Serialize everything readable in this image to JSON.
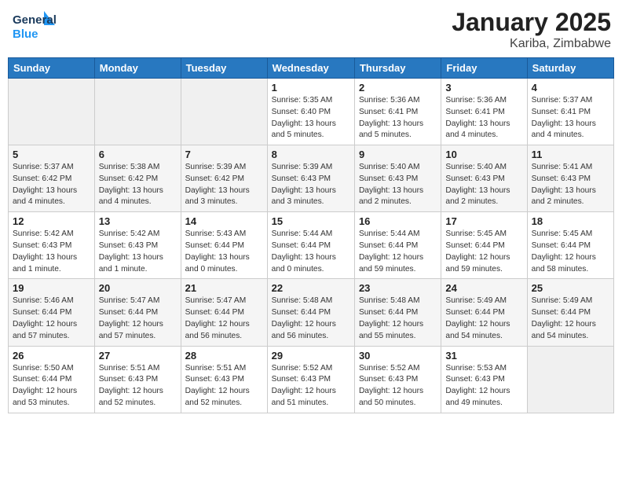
{
  "header": {
    "logo_line1": "General",
    "logo_line2": "Blue",
    "month": "January 2025",
    "location": "Kariba, Zimbabwe"
  },
  "days_of_week": [
    "Sunday",
    "Monday",
    "Tuesday",
    "Wednesday",
    "Thursday",
    "Friday",
    "Saturday"
  ],
  "weeks": [
    [
      {
        "num": "",
        "info": ""
      },
      {
        "num": "",
        "info": ""
      },
      {
        "num": "",
        "info": ""
      },
      {
        "num": "1",
        "info": "Sunrise: 5:35 AM\nSunset: 6:40 PM\nDaylight: 13 hours\nand 5 minutes."
      },
      {
        "num": "2",
        "info": "Sunrise: 5:36 AM\nSunset: 6:41 PM\nDaylight: 13 hours\nand 5 minutes."
      },
      {
        "num": "3",
        "info": "Sunrise: 5:36 AM\nSunset: 6:41 PM\nDaylight: 13 hours\nand 4 minutes."
      },
      {
        "num": "4",
        "info": "Sunrise: 5:37 AM\nSunset: 6:41 PM\nDaylight: 13 hours\nand 4 minutes."
      }
    ],
    [
      {
        "num": "5",
        "info": "Sunrise: 5:37 AM\nSunset: 6:42 PM\nDaylight: 13 hours\nand 4 minutes."
      },
      {
        "num": "6",
        "info": "Sunrise: 5:38 AM\nSunset: 6:42 PM\nDaylight: 13 hours\nand 4 minutes."
      },
      {
        "num": "7",
        "info": "Sunrise: 5:39 AM\nSunset: 6:42 PM\nDaylight: 13 hours\nand 3 minutes."
      },
      {
        "num": "8",
        "info": "Sunrise: 5:39 AM\nSunset: 6:43 PM\nDaylight: 13 hours\nand 3 minutes."
      },
      {
        "num": "9",
        "info": "Sunrise: 5:40 AM\nSunset: 6:43 PM\nDaylight: 13 hours\nand 2 minutes."
      },
      {
        "num": "10",
        "info": "Sunrise: 5:40 AM\nSunset: 6:43 PM\nDaylight: 13 hours\nand 2 minutes."
      },
      {
        "num": "11",
        "info": "Sunrise: 5:41 AM\nSunset: 6:43 PM\nDaylight: 13 hours\nand 2 minutes."
      }
    ],
    [
      {
        "num": "12",
        "info": "Sunrise: 5:42 AM\nSunset: 6:43 PM\nDaylight: 13 hours\nand 1 minute."
      },
      {
        "num": "13",
        "info": "Sunrise: 5:42 AM\nSunset: 6:43 PM\nDaylight: 13 hours\nand 1 minute."
      },
      {
        "num": "14",
        "info": "Sunrise: 5:43 AM\nSunset: 6:44 PM\nDaylight: 13 hours\nand 0 minutes."
      },
      {
        "num": "15",
        "info": "Sunrise: 5:44 AM\nSunset: 6:44 PM\nDaylight: 13 hours\nand 0 minutes."
      },
      {
        "num": "16",
        "info": "Sunrise: 5:44 AM\nSunset: 6:44 PM\nDaylight: 12 hours\nand 59 minutes."
      },
      {
        "num": "17",
        "info": "Sunrise: 5:45 AM\nSunset: 6:44 PM\nDaylight: 12 hours\nand 59 minutes."
      },
      {
        "num": "18",
        "info": "Sunrise: 5:45 AM\nSunset: 6:44 PM\nDaylight: 12 hours\nand 58 minutes."
      }
    ],
    [
      {
        "num": "19",
        "info": "Sunrise: 5:46 AM\nSunset: 6:44 PM\nDaylight: 12 hours\nand 57 minutes."
      },
      {
        "num": "20",
        "info": "Sunrise: 5:47 AM\nSunset: 6:44 PM\nDaylight: 12 hours\nand 57 minutes."
      },
      {
        "num": "21",
        "info": "Sunrise: 5:47 AM\nSunset: 6:44 PM\nDaylight: 12 hours\nand 56 minutes."
      },
      {
        "num": "22",
        "info": "Sunrise: 5:48 AM\nSunset: 6:44 PM\nDaylight: 12 hours\nand 56 minutes."
      },
      {
        "num": "23",
        "info": "Sunrise: 5:48 AM\nSunset: 6:44 PM\nDaylight: 12 hours\nand 55 minutes."
      },
      {
        "num": "24",
        "info": "Sunrise: 5:49 AM\nSunset: 6:44 PM\nDaylight: 12 hours\nand 54 minutes."
      },
      {
        "num": "25",
        "info": "Sunrise: 5:49 AM\nSunset: 6:44 PM\nDaylight: 12 hours\nand 54 minutes."
      }
    ],
    [
      {
        "num": "26",
        "info": "Sunrise: 5:50 AM\nSunset: 6:44 PM\nDaylight: 12 hours\nand 53 minutes."
      },
      {
        "num": "27",
        "info": "Sunrise: 5:51 AM\nSunset: 6:43 PM\nDaylight: 12 hours\nand 52 minutes."
      },
      {
        "num": "28",
        "info": "Sunrise: 5:51 AM\nSunset: 6:43 PM\nDaylight: 12 hours\nand 52 minutes."
      },
      {
        "num": "29",
        "info": "Sunrise: 5:52 AM\nSunset: 6:43 PM\nDaylight: 12 hours\nand 51 minutes."
      },
      {
        "num": "30",
        "info": "Sunrise: 5:52 AM\nSunset: 6:43 PM\nDaylight: 12 hours\nand 50 minutes."
      },
      {
        "num": "31",
        "info": "Sunrise: 5:53 AM\nSunset: 6:43 PM\nDaylight: 12 hours\nand 49 minutes."
      },
      {
        "num": "",
        "info": ""
      }
    ]
  ]
}
